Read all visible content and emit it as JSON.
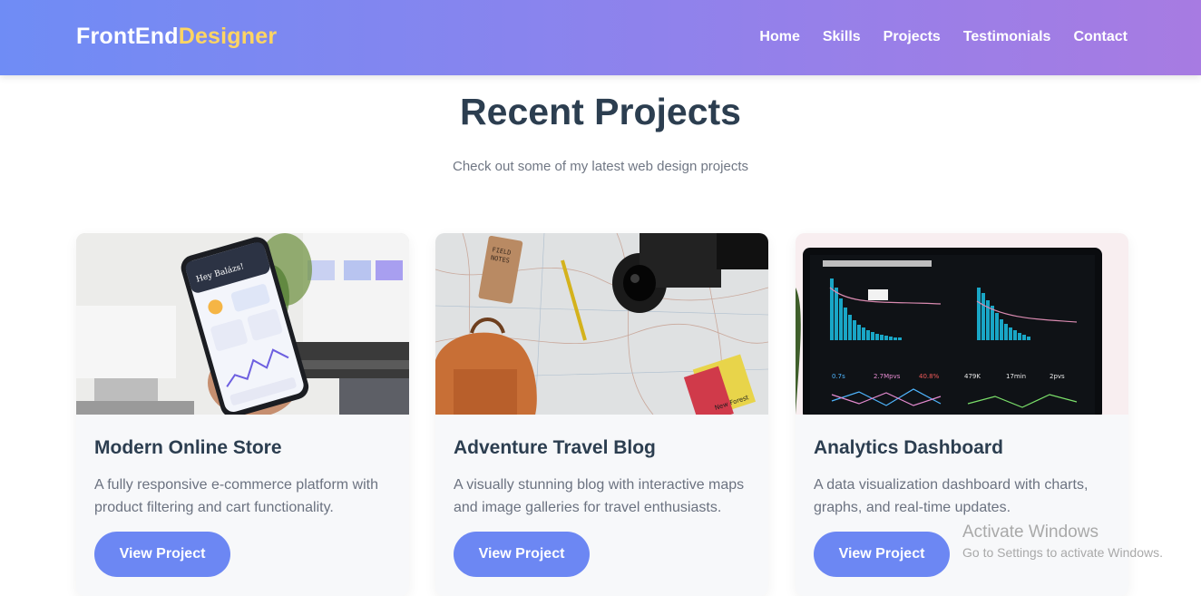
{
  "nav": {
    "logo_main": "FrontEnd",
    "logo_accent": "Designer",
    "links": [
      "Home",
      "Skills",
      "Projects",
      "Testimonials",
      "Contact"
    ]
  },
  "section": {
    "title": "Recent Projects",
    "subtitle": "Check out some of my latest web design projects"
  },
  "projects": [
    {
      "title": "Modern Online Store",
      "description": "A fully responsive e-commerce platform with product filtering and cart functionality.",
      "button": "View Project",
      "image": "phone-app-photo"
    },
    {
      "title": "Adventure Travel Blog",
      "description": "A visually stunning blog with interactive maps and image galleries for travel enthusiasts.",
      "button": "View Project",
      "image": "travel-map-photo"
    },
    {
      "title": "Analytics Dashboard",
      "description": "A data visualization dashboard with charts, graphs, and real-time updates.",
      "button": "View Project",
      "image": "dashboard-screen-photo"
    }
  ],
  "overlay": {
    "activate_title": "Activate Windows",
    "activate_sub": "Go to Settings to activate Windows."
  },
  "colors": {
    "accent": "#6c87f3",
    "logo_accent": "#ffd562",
    "heading": "#2c3e50"
  }
}
